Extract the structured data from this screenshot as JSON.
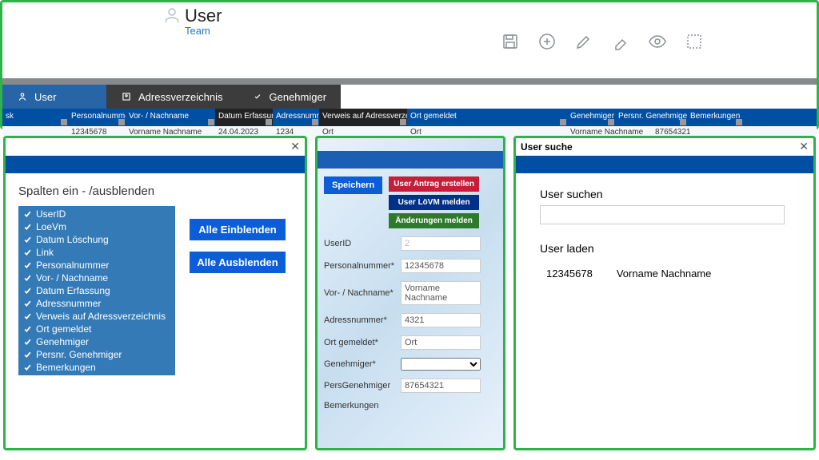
{
  "header": {
    "title": "User",
    "subtitle": "Team"
  },
  "tabs": {
    "user": "User",
    "addr": "Adressverzeichnis",
    "gen": "Genehmiger"
  },
  "cols": [
    "sk",
    "Personalnummer",
    "Vor- / Nachname",
    "Datum Erfassung",
    "Adressnummer",
    "Verweis auf Adressverzeichnis",
    "Ort gemeldet",
    "",
    "Genehmiger",
    "Persnr. Genehmiger",
    "Bemerkungen"
  ],
  "row": {
    "pnr": "12345678",
    "name": "Vorname Nachname",
    "datum": "24.04.2023",
    "adr": "1234",
    "ort1": "Ort",
    "ort2": "Ort",
    "gen": "Vorname Nachname",
    "pg": "87654321"
  },
  "p1": {
    "title": "Spalten ein - /ausblenden",
    "items": [
      "UserID",
      "LoeVm",
      "Datum Löschung",
      "Link",
      "Personalnummer",
      "Vor- / Nachname",
      "Datum Erfassung",
      "Adressnummer",
      "Verweis auf Adressverzeichnis",
      "Ort gemeldet",
      "Genehmiger",
      "Persnr. Genehmiger",
      "Bemerkungen"
    ],
    "btn_show": "Alle Einblenden",
    "btn_hide": "Alle Ausblenden"
  },
  "p2": {
    "save": "Speichern",
    "act1": "User Antrag erstellen",
    "act2": "User LöVM melden",
    "act3": "Änderungen melden",
    "fields": {
      "userid_l": "UserID",
      "userid_v": "2",
      "pnr_l": "Personalnummer*",
      "pnr_v": "12345678",
      "name_l": "Vor- / Nachname*",
      "name_v": "Vorname Nachname",
      "adr_l": "Adressnummer*",
      "adr_v": "4321",
      "ort_l": "Ort gemeldet*",
      "ort_v": "Ort",
      "gen_l": "Genehmiger*",
      "pg_l": "PersGenehmiger",
      "pg_v": "87654321",
      "bem_l": "Bemerkungen"
    }
  },
  "p3": {
    "title": "User suche",
    "search_l": "User suchen",
    "load_l": "User laden",
    "id": "12345678",
    "name": "Vorname Nachname"
  }
}
